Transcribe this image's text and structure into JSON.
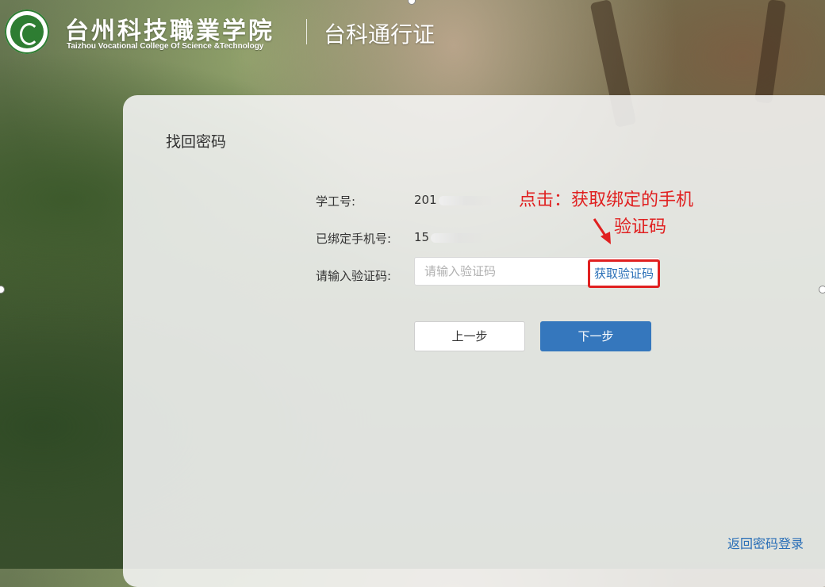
{
  "header": {
    "school_name_cn": "台州科技職業学院",
    "school_name_en": "Taizhou Vocational College Of Science &Technology",
    "app_name": "台科通行证"
  },
  "form": {
    "title": "找回密码",
    "student_id_label": "学工号:",
    "student_id_value": "201",
    "phone_label": "已绑定手机号:",
    "phone_value": "15",
    "code_label": "请输入验证码:",
    "code_placeholder": "请输入验证码",
    "code_value": "",
    "get_code_label": "获取验证码",
    "prev_button": "上一步",
    "next_button": "下一步",
    "back_login_link": "返回密码登录"
  },
  "annotation": {
    "line1": "点击：获取绑定的手机",
    "line2": "验证码",
    "color": "#e02020"
  },
  "colors": {
    "primary_button": "#3577bd",
    "link": "#2a6fb7",
    "highlight_box": "#e02020"
  },
  "icons": {
    "logo": "school-seal-logo",
    "arrow": "red-arrow-icon"
  }
}
